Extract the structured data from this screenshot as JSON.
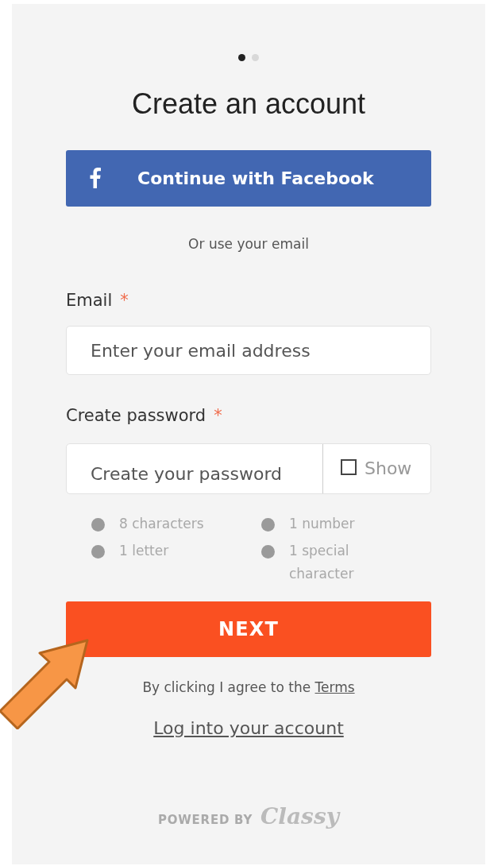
{
  "pager": [
    {
      "selected": true
    },
    {
      "selected": false
    }
  ],
  "title": "Create an account",
  "facebook_button": "Continue with Facebook",
  "divider_text": "Or use your email",
  "email": {
    "label": "Email",
    "required_mark": "*",
    "placeholder": "Enter your email address"
  },
  "password": {
    "label": "Create password",
    "required_mark": "*",
    "placeholder": "Create your password",
    "show_label": "Show",
    "show_checked": false
  },
  "requirements": [
    {
      "text": "8 characters",
      "met": false
    },
    {
      "text": "1 number",
      "met": false
    },
    {
      "text": "1 letter",
      "met": false
    },
    {
      "text": "1 special character",
      "met": false
    }
  ],
  "next_button": "NEXT",
  "terms": {
    "text": "By clicking I agree to the",
    "link": "Terms"
  },
  "login_link": "Log into your account",
  "footer": {
    "powered_by": "POWERED BY",
    "brand": "Classy"
  }
}
